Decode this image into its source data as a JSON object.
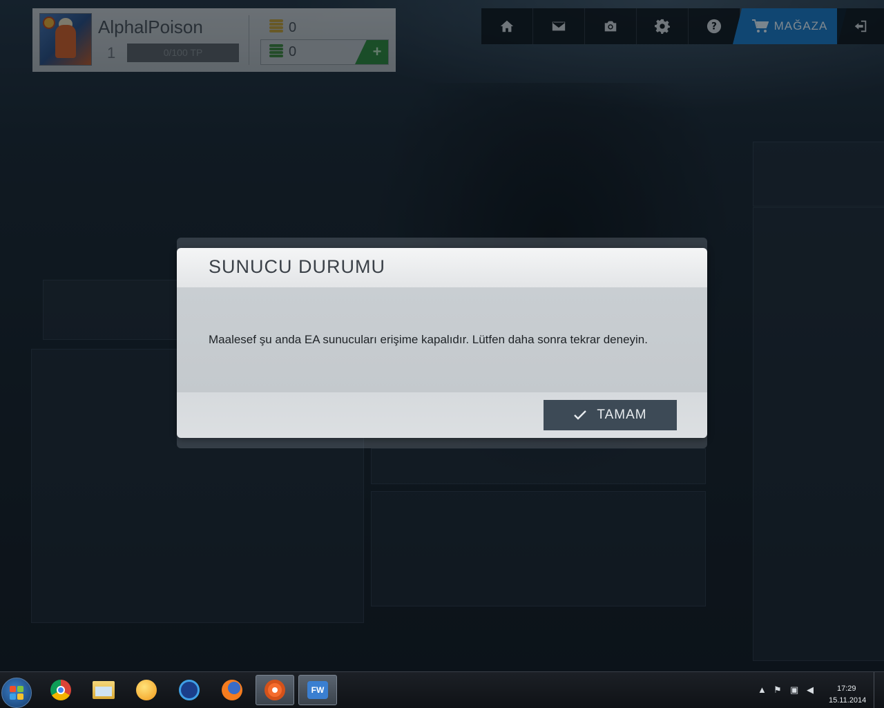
{
  "profile": {
    "username": "AlphalPoison",
    "level": "1",
    "tp_progress": "0/100 TP",
    "coins": "0",
    "points": "0",
    "add_points_symbol": "+"
  },
  "nav": {
    "items": [
      "home-icon",
      "mail-icon",
      "camera-icon",
      "settings-icon",
      "help-icon"
    ],
    "store_label": "MAĞAZA"
  },
  "dialog": {
    "title": "SUNUCU DURUMU",
    "message": "Maalesef şu anda EA sunucuları erişime kapalıdır. Lütfen daha sonra tekrar deneyin.",
    "ok_label": "TAMAM"
  },
  "taskbar": {
    "apps": [
      "chrome-icon",
      "explorer-icon",
      "messenger-icon",
      "ccleaner-icon",
      "firefox-icon",
      "origin-icon",
      "fifaworld-icon"
    ],
    "time": "17:29",
    "date": "15.11.2014"
  },
  "colors": {
    "store_accent": "#1a77c4",
    "points_green": "#2f8c3c",
    "ok_button": "#3d4a56"
  }
}
